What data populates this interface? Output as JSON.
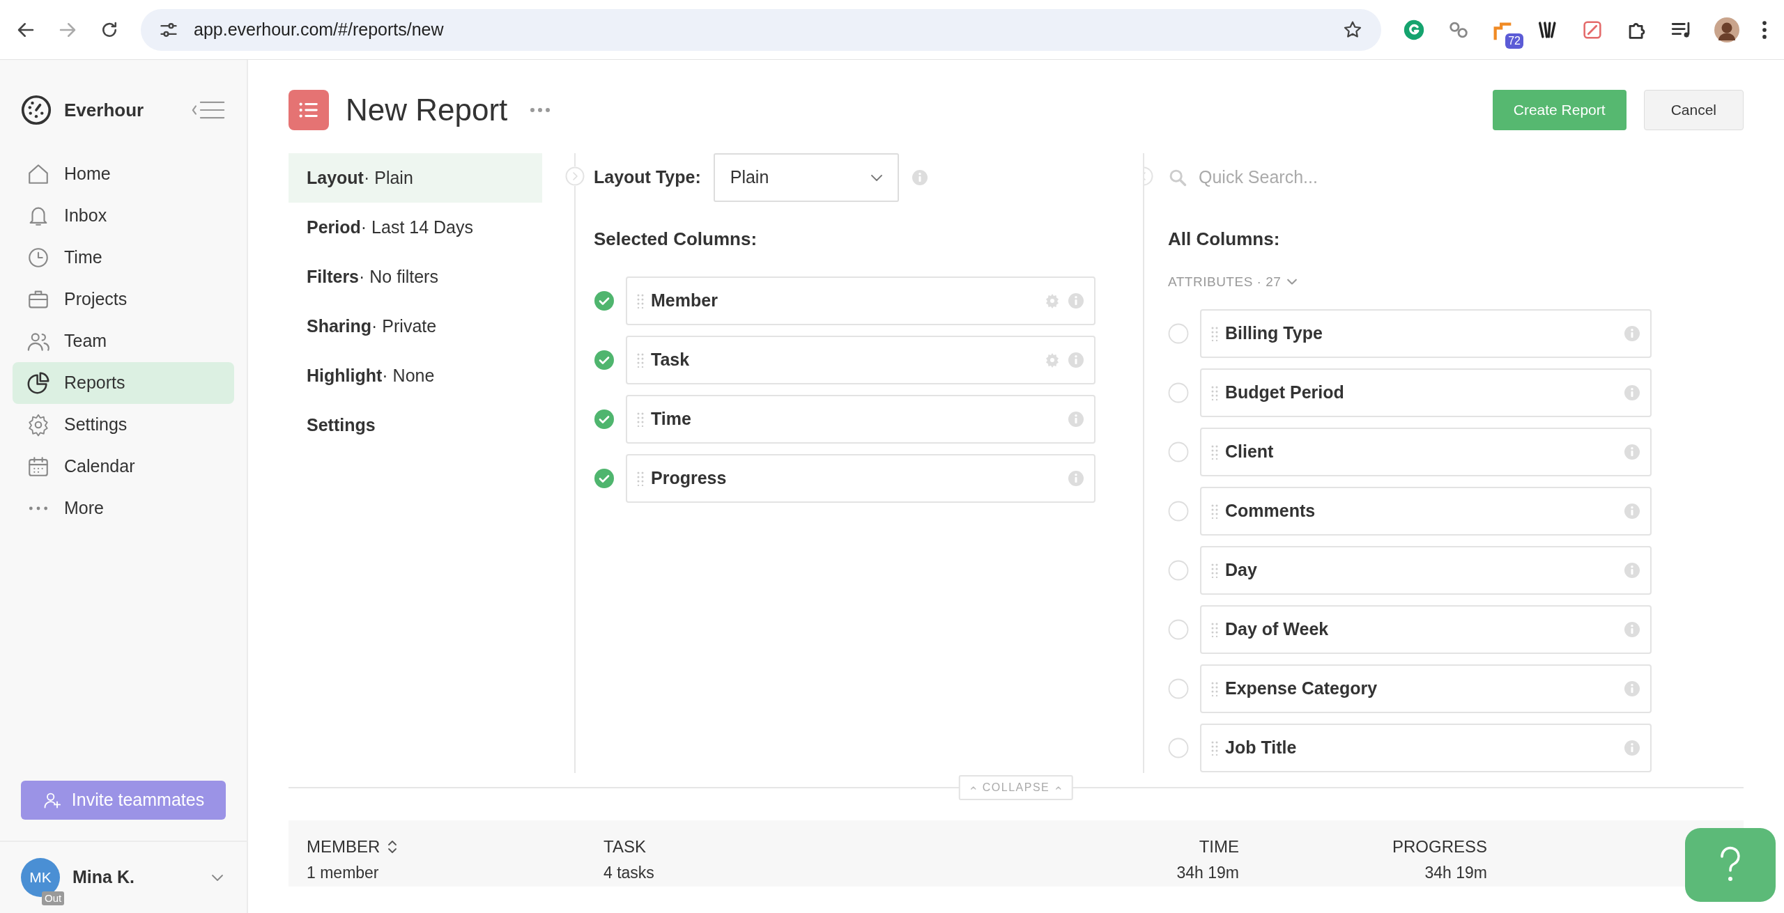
{
  "browser": {
    "url": "app.everhour.com/#/reports/new",
    "extension_badge": "72"
  },
  "sidebar": {
    "brand": "Everhour",
    "items": [
      {
        "label": "Home",
        "selected": false
      },
      {
        "label": "Inbox",
        "selected": false
      },
      {
        "label": "Time",
        "selected": false
      },
      {
        "label": "Projects",
        "selected": false
      },
      {
        "label": "Team",
        "selected": false
      },
      {
        "label": "Reports",
        "selected": true
      },
      {
        "label": "Settings",
        "selected": false
      },
      {
        "label": "Calendar",
        "selected": false
      },
      {
        "label": "More",
        "selected": false
      }
    ],
    "invite_button": "Invite teammates",
    "user": {
      "initials": "MK",
      "name": "Mina K.",
      "status": "Out"
    }
  },
  "header": {
    "title": "New Report",
    "buttons": [
      {
        "label": "Create Report",
        "kind": "primary"
      },
      {
        "label": "Cancel",
        "kind": "secondary"
      }
    ]
  },
  "menu": [
    {
      "label": "Layout",
      "value": "· Plain",
      "selected": true
    },
    {
      "label": "Period",
      "value": "· Last 14 Days",
      "selected": false
    },
    {
      "label": "Filters",
      "value": "· No filters",
      "selected": false
    },
    {
      "label": "Sharing",
      "value": "· Private",
      "selected": false
    },
    {
      "label": "Highlight",
      "value": "· None",
      "selected": false
    },
    {
      "label": "Settings",
      "selected": false
    }
  ],
  "layout_type": {
    "label": "Layout Type:",
    "value": "Plain"
  },
  "selected_columns": {
    "title": "Selected Columns:",
    "items": [
      {
        "label": "Member",
        "checked": true,
        "configurable": true
      },
      {
        "label": "Task",
        "checked": true,
        "configurable": true
      },
      {
        "label": "Time",
        "checked": true,
        "configurable": false
      },
      {
        "label": "Progress",
        "checked": true,
        "configurable": false
      }
    ]
  },
  "search": {
    "placeholder": "Quick Search..."
  },
  "all_columns": {
    "title": "All Columns:",
    "group": "ATTRIBUTES · 27",
    "items": [
      {
        "label": "Billing Type",
        "checked": false
      },
      {
        "label": "Budget Period",
        "checked": false
      },
      {
        "label": "Client",
        "checked": false
      },
      {
        "label": "Comments",
        "checked": false
      },
      {
        "label": "Day",
        "checked": false
      },
      {
        "label": "Day of Week",
        "checked": false
      },
      {
        "label": "Expense Category",
        "checked": false
      },
      {
        "label": "Job Title",
        "checked": false
      }
    ]
  },
  "collapse": "COLLAPSE",
  "table": {
    "columns": [
      {
        "label": "MEMBER",
        "sortable": true,
        "summary": "1 member"
      },
      {
        "label": "TASK",
        "sortable": false,
        "summary": "4 tasks"
      },
      {
        "label": "TIME",
        "sortable": false,
        "summary": "34h 19m"
      },
      {
        "label": "PROGRESS",
        "sortable": false,
        "summary": "34h 19m"
      }
    ]
  }
}
